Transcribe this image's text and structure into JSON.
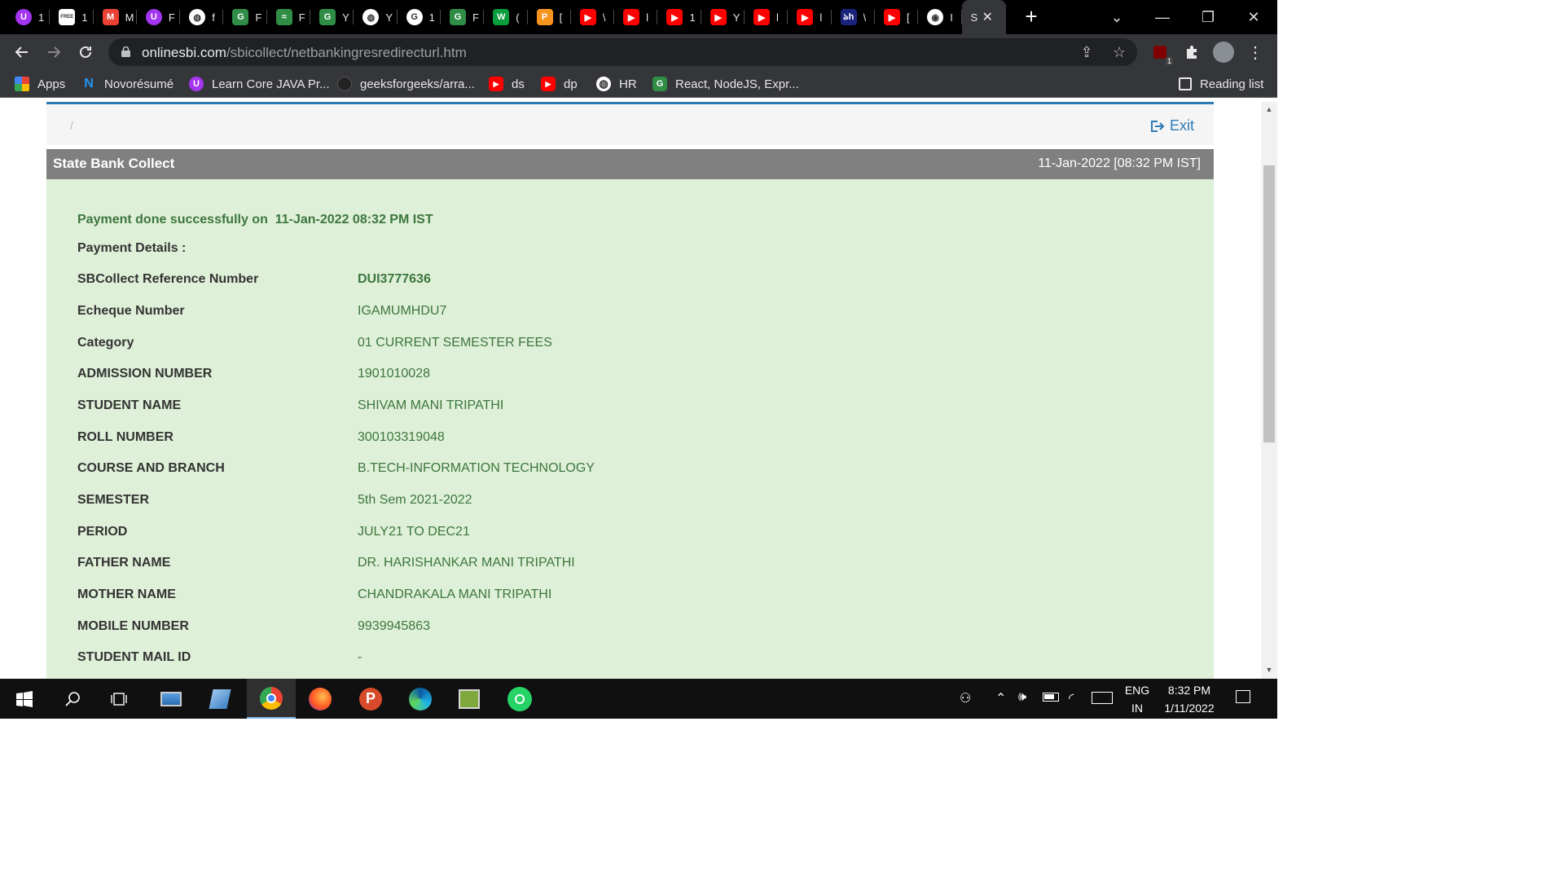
{
  "browser": {
    "tabs": [
      {
        "icon": "udemy-icon",
        "color": "#a435f0",
        "glyph": "U",
        "title": "1"
      },
      {
        "icon": "freecodecamp-icon",
        "color": "#ffffff",
        "glyph": "FREE",
        "title": "1"
      },
      {
        "icon": "gmail-icon",
        "color": "#ea4335",
        "glyph": "M",
        "title": "M"
      },
      {
        "icon": "udemy-icon",
        "color": "#a435f0",
        "glyph": "U",
        "title": "F"
      },
      {
        "icon": "globe-icon",
        "color": "#ffffff",
        "glyph": "◍",
        "title": "f"
      },
      {
        "icon": "gfg-icon",
        "color": "#2f8d46",
        "glyph": "G",
        "title": "F"
      },
      {
        "icon": "gfg-icon",
        "color": "#2f8d46",
        "glyph": "≈",
        "title": "F"
      },
      {
        "icon": "gfg-icon",
        "color": "#2f8d46",
        "glyph": "G",
        "title": "Y"
      },
      {
        "icon": "globe-icon",
        "color": "#ffffff",
        "glyph": "◍",
        "title": "Y"
      },
      {
        "icon": "google-icon",
        "color": "#ffffff",
        "glyph": "G",
        "title": "1"
      },
      {
        "icon": "gfg-icon",
        "color": "#2f8d46",
        "glyph": "G",
        "title": "F"
      },
      {
        "icon": "w-icon",
        "color": "#0b9c3b",
        "glyph": "W",
        "title": "("
      },
      {
        "icon": "p-icon",
        "color": "#f7941d",
        "glyph": "P",
        "title": "["
      },
      {
        "icon": "youtube-icon",
        "color": "#ff0000",
        "glyph": "▶",
        "title": "\\"
      },
      {
        "icon": "youtube-icon",
        "color": "#ff0000",
        "glyph": "▶",
        "title": "l"
      },
      {
        "icon": "youtube-icon",
        "color": "#ff0000",
        "glyph": "▶",
        "title": "1"
      },
      {
        "icon": "youtube-icon",
        "color": "#ff0000",
        "glyph": "▶",
        "title": "Y"
      },
      {
        "icon": "youtube-icon",
        "color": "#ff0000",
        "glyph": "▶",
        "title": "l"
      },
      {
        "icon": "youtube-icon",
        "color": "#ff0000",
        "glyph": "▶",
        "title": "l"
      },
      {
        "icon": "bh-icon",
        "color": "#1a237e",
        "glyph": "ঌh",
        "title": "\\"
      },
      {
        "icon": "youtube-icon",
        "color": "#ff0000",
        "glyph": "▶",
        "title": "["
      },
      {
        "icon": "chrome-icon",
        "color": "#ffffff",
        "glyph": "◉",
        "title": "I"
      }
    ],
    "active_tab": {
      "title": "S",
      "close": "✕"
    },
    "new_tab": "+",
    "window_controls": {
      "dropdown": "⌄",
      "minimize": "—",
      "restore": "❐",
      "close": "✕"
    },
    "url": {
      "host": "onlinesbi.com",
      "path": "/sbicollect/netbankingresredirecturl.htm"
    },
    "extension_badge": "1",
    "bookmarks": [
      {
        "label": "Apps",
        "icon": "apps-grid-icon"
      },
      {
        "label": "Novorésumé",
        "icon": "novoresume-icon"
      },
      {
        "label": "Learn Core JAVA Pr...",
        "icon": "udemy-icon"
      },
      {
        "label": "geeksforgeeks/arra...",
        "icon": "github-icon"
      },
      {
        "label": "ds",
        "icon": "youtube-icon"
      },
      {
        "label": "dp",
        "icon": "youtube-icon"
      },
      {
        "label": "HR",
        "icon": "globe-icon"
      },
      {
        "label": "React, NodeJS, Expr...",
        "icon": "gfg-icon"
      }
    ],
    "reading_list": "Reading list"
  },
  "page": {
    "breadcrumb": "/",
    "exit_label": "Exit",
    "title": "State Bank Collect",
    "datetime": "11-Jan-2022 [08:32 PM IST]",
    "success_prefix": "Payment done successfully on ",
    "success_time": " 11-Jan-2022 08:32 PM IST",
    "details_heading": "Payment Details :",
    "details": [
      {
        "key": "SBCollect Reference Number",
        "value": "DUI3777636",
        "strong": true
      },
      {
        "key": "Echeque Number",
        "value": "IGAMUMHDU7"
      },
      {
        "key": "Category",
        "value": "01 CURRENT SEMESTER FEES"
      },
      {
        "key": "ADMISSION NUMBER",
        "value": "1901010028"
      },
      {
        "key": "STUDENT NAME",
        "value": "SHIVAM MANI TRIPATHI"
      },
      {
        "key": "ROLL NUMBER",
        "value": "300103319048"
      },
      {
        "key": "COURSE AND BRANCH",
        "value": "B.TECH-INFORMATION TECHNOLOGY"
      },
      {
        "key": "SEMESTER",
        "value": "5th Sem 2021-2022"
      },
      {
        "key": "PERIOD",
        "value": "JULY21 TO DEC21"
      },
      {
        "key": "FATHER NAME",
        "value": "DR. HARISHANKAR MANI TRIPATHI"
      },
      {
        "key": "MOTHER NAME",
        "value": "CHANDRAKALA MANI TRIPATHI"
      },
      {
        "key": "MOBILE NUMBER",
        "value": "9939945863"
      },
      {
        "key": "STUDENT MAIL ID",
        "value": "-"
      }
    ]
  },
  "taskbar": {
    "apps": [
      "windows-start-icon",
      "search-icon",
      "task-view-icon",
      "laptop-icon",
      "notepad-icon",
      "chrome-icon",
      "firefox-icon",
      "powerpoint-icon",
      "edge-icon",
      "photo-app-icon",
      "whatsapp-icon"
    ],
    "language_top": "ENG",
    "language_bottom": "IN",
    "time": "8:32 PM",
    "date": "1/11/2022"
  }
}
